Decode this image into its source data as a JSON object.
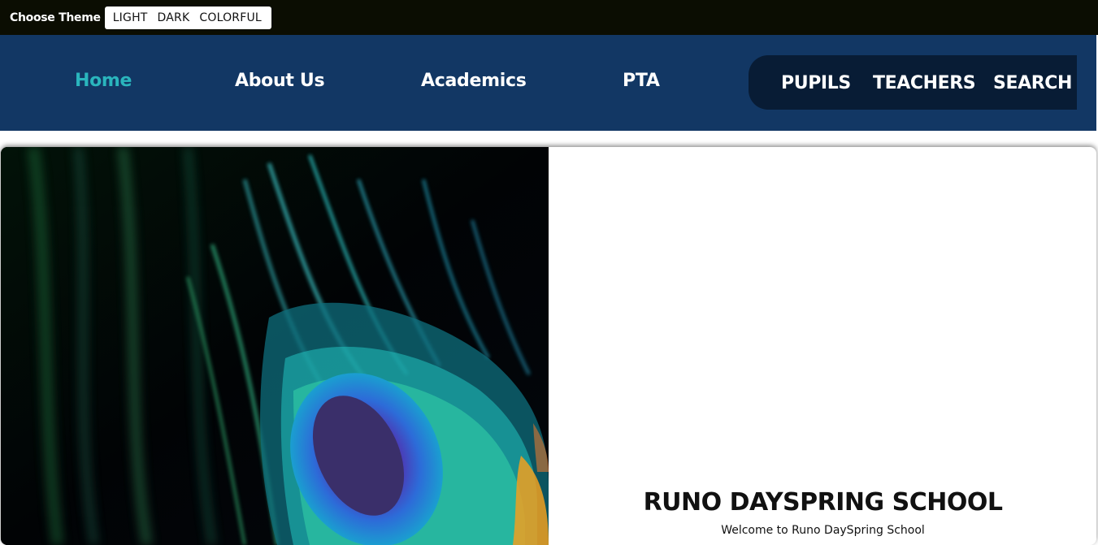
{
  "theme_bar": {
    "label": "Choose Theme",
    "options": [
      "LIGHT",
      "DARK",
      "COLORFUL"
    ]
  },
  "nav": {
    "links": [
      "Home",
      "About Us",
      "Academics",
      "PTA"
    ],
    "active": "Home",
    "pill_links": [
      "PUPILS",
      "TEACHERS",
      "SEARCH"
    ]
  },
  "hero": {
    "image": "peacock-feather-photo",
    "school_name": "RUNO DAYSPRING SCHOOL",
    "welcome": "Welcome to Runo DaySpring School"
  },
  "colors": {
    "theme_bar_bg": "#0b0d02",
    "nav_bg": "#123764",
    "pill_bg": "#081c35",
    "active_link": "#2ab5bd"
  }
}
